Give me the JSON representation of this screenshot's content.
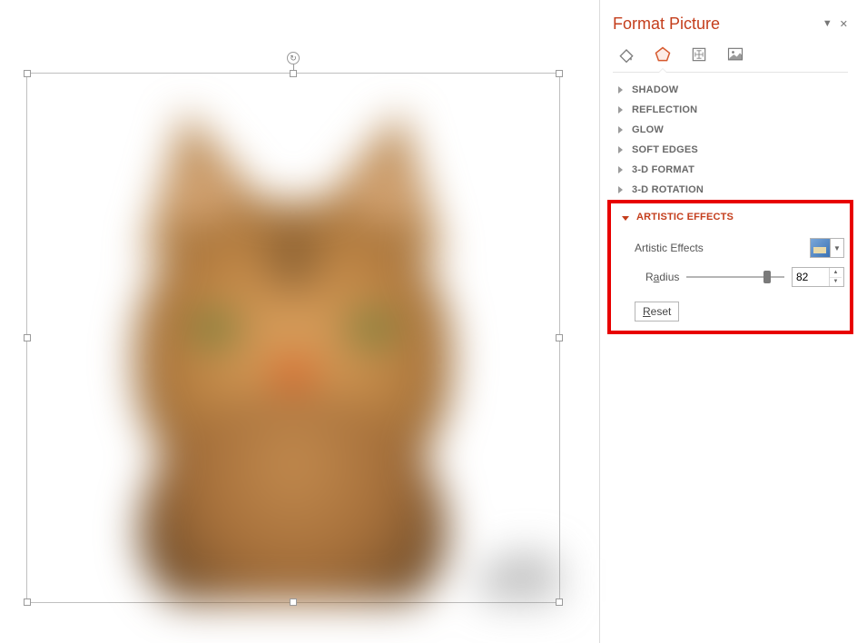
{
  "panel": {
    "title": "Format Picture",
    "tabs": {
      "fill_line": "Fill & Line",
      "effects": "Effects",
      "size_props": "Size & Properties",
      "picture": "Picture"
    },
    "sections": {
      "shadow": "SHADOW",
      "reflection": "REFLECTION",
      "glow": "GLOW",
      "soft_edges": "SOFT EDGES",
      "format3d": "3-D FORMAT",
      "rotation3d": "3-D ROTATION",
      "artistic": "ARTISTIC EFFECTS"
    },
    "artistic": {
      "label": "Artistic Effects",
      "radius_label_pre": "R",
      "radius_label_ul": "a",
      "radius_label_post": "dius",
      "radius_value": "82",
      "radius_percent": 82,
      "reset_pre": "",
      "reset_ul": "R",
      "reset_post": "eset"
    }
  }
}
